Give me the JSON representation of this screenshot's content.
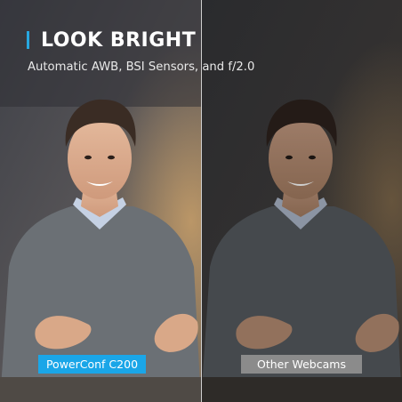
{
  "headline": "LOOK BRIGHT",
  "subheadline": "Automatic AWB, BSI Sensors, and f/2.0",
  "labels": {
    "left": "PowerConf C200",
    "right": "Other Webcams"
  },
  "colors": {
    "accent": "#27a8e0",
    "left_label_bg": "#1aa6e8",
    "right_label_bg": "#8b8b8b",
    "headline_text": "#ffffff",
    "divider": "#cfcfcf"
  },
  "icons": [
    "person-photo",
    "accent-bar"
  ]
}
